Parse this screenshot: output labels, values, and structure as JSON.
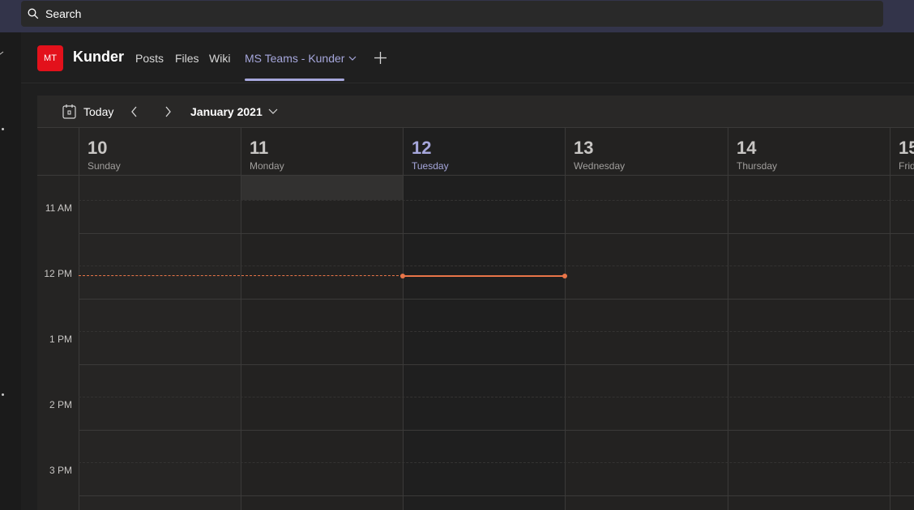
{
  "search": {
    "placeholder": "Search"
  },
  "team": {
    "avatar_initials": "MT",
    "avatar_color": "#e3111b",
    "name": "Kunder",
    "tabs": [
      {
        "label": "Posts"
      },
      {
        "label": "Files"
      },
      {
        "label": "Wiki"
      },
      {
        "label": "MS Teams - Kunder",
        "active": true
      }
    ],
    "add_tab_icon": "plus-icon"
  },
  "toolbar": {
    "today_label": "Today",
    "month_label": "January 2021"
  },
  "days": [
    {
      "num": "10",
      "name": "Sunday"
    },
    {
      "num": "11",
      "name": "Monday"
    },
    {
      "num": "12",
      "name": "Tuesday",
      "today": true
    },
    {
      "num": "13",
      "name": "Wednesday"
    },
    {
      "num": "14",
      "name": "Thursday"
    },
    {
      "num": "15",
      "name": "Frid"
    }
  ],
  "times": [
    "11 AM",
    "12 PM",
    "1 PM",
    "2 PM",
    "3 PM"
  ],
  "colors": {
    "accent": "#a6a7dc",
    "current_time": "#e97548",
    "topbar": "#33344a"
  }
}
